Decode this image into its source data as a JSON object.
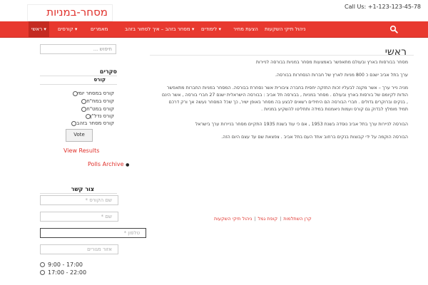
{
  "header": {
    "logo": "מסחר-במניות",
    "call_us": "Call Us: +1-123-123-45-78"
  },
  "nav": {
    "items": [
      {
        "label": "ראשי",
        "caret": "▾"
      },
      {
        "label": "קורסים",
        "caret": "▾"
      },
      {
        "label": "מאמרים"
      },
      {
        "label": "מסחר בזהב – איך לסחור בזהב",
        "caret": "▾"
      },
      {
        "label": "לימודים",
        "caret": "▾"
      },
      {
        "label": "הצעת מחיר"
      },
      {
        "label": "ניהול תיקי השקעות"
      }
    ]
  },
  "sidebar": {
    "search_placeholder": "חיפוש ...",
    "polls_title": "סקרים",
    "poll_question": "קורס",
    "poll_options": [
      "קורס במסחר יומי",
      "קורס במח\"ח",
      "קורס במט\"ח",
      "קורס נדל\"ן",
      "קורס מסחר בזהב"
    ],
    "vote_label": "Vote",
    "view_results": "View Results",
    "polls_archive": "Polls Archive",
    "contact_title": "צור קשר",
    "fields": [
      "שם הקורס *",
      "שם *",
      "טלפון *",
      "אזור מגורים"
    ],
    "times": [
      "9:00 - 17:00",
      "17:00 - 22:00"
    ]
  },
  "main": {
    "title": "ראשי",
    "paragraphs": [
      "מסחר בבורסות בארץ ובעולם מתאפשר באמצעות מסחר במניות בבורסה לניירות",
      "ערך בתל אביב ישנם כ 800 מניות לארץ של חברות הנסחרות בבורסה.",
      "מניה נייר ערך – אשר מקנה לבעליו זכות החזקה יחסית בחברה ציבורית אשר נסחרת בבורסה. המסחר במניות החברות מתאפשר",
      "הודות לקיומם של בורסות בארץ ובעולם . מסחר במניות , בבורסה תל אביב : בבורסה הישראלית ישנם 27 חברי בורסה , אשר הינם",
      ", בנקים וברוקרים גדולים . חברי הבורסה הם היחידים רשאים לבצע בה מסחר באופן ישיר, כך שכל המסחר נעשה אך ורק דרכם",
      "תמיד מומלץ לבדוק גם קורס ועמות ניאמנות במידה ותחליטו להשקיע במניות .",
      "הבורסה לניירות ערך בתל אביב נוסדה בשנת 1953 , אם כי עוד בשנת 1935 התקיים מסחר בניירות ערך בישראל",
      "הבורסה הוקמה על ידי קבוצות בנקים ברחוב אחד העם בתל אביב . צפצאת שם עד עצם היום הזה."
    ],
    "footer_links": [
      "קרן השתלמות",
      "קופת גמל",
      "ניהול תיקי השקעות"
    ],
    "footer_sep": "|"
  },
  "colors": {
    "accent": "#e8392f",
    "link": "#e0312b"
  }
}
